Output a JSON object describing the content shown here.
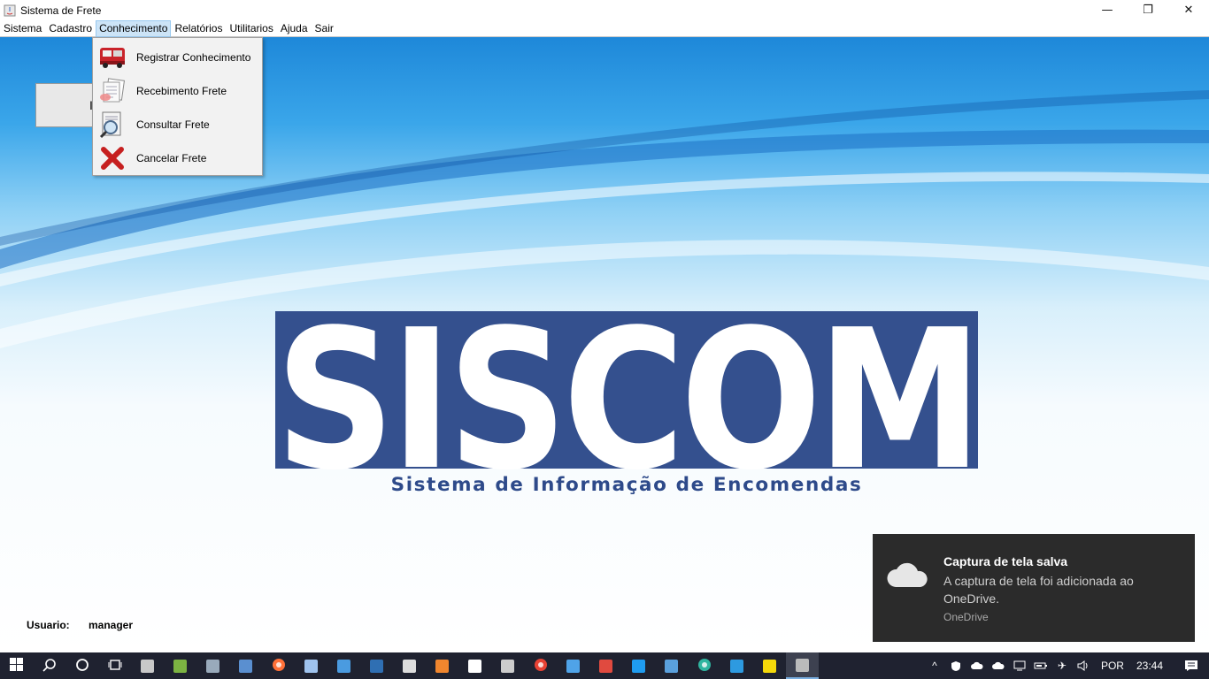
{
  "window": {
    "title": "Sistema de Frete",
    "controls": {
      "minimize": "—",
      "maximize": "❐",
      "close": "✕"
    }
  },
  "menubar": {
    "items": [
      {
        "label": "Sistema"
      },
      {
        "label": "Cadastro"
      },
      {
        "label": "Conhecimento",
        "active": true
      },
      {
        "label": "Relatórios"
      },
      {
        "label": "Utilitarios"
      },
      {
        "label": "Ajuda"
      },
      {
        "label": "Sair"
      }
    ]
  },
  "dropdown": {
    "items": [
      {
        "label": "Registrar Conhecimento",
        "icon": "truck-icon"
      },
      {
        "label": "Recebimento Frete",
        "icon": "documents-icon"
      },
      {
        "label": "Consultar Frete",
        "icon": "magnifier-document-icon"
      },
      {
        "label": "Cancelar Frete",
        "icon": "red-x-icon"
      }
    ]
  },
  "main": {
    "hidden_button_label": "I",
    "logo_text": "SISCOM",
    "logo_subtitle": "Sistema de Informação de Encomendas",
    "user_label": "Usuario:",
    "user_value": "manager"
  },
  "toast": {
    "title": "Captura de tela salva",
    "body": "A captura de tela foi adicionada ao OneDrive.",
    "source": "OneDrive"
  },
  "taskbar": {
    "icons": [
      {
        "name": "start-icon",
        "color": "#ffffff"
      },
      {
        "name": "search-icon",
        "color": "#ffffff"
      },
      {
        "name": "cortana-icon",
        "color": "#ffffff"
      },
      {
        "name": "task-view-icon",
        "color": "#ffffff"
      },
      {
        "name": "app-icon-1",
        "color": "#c8c8c8"
      },
      {
        "name": "android-studio-icon",
        "color": "#7cb342"
      },
      {
        "name": "app-icon-3",
        "color": "#9ab"
      },
      {
        "name": "app-icon-4",
        "color": "#5a8fd0"
      },
      {
        "name": "firefox-icon",
        "color": "#ff7139"
      },
      {
        "name": "virtualbox-icon",
        "color": "#9fc3ee"
      },
      {
        "name": "app-icon-7",
        "color": "#4a9be0"
      },
      {
        "name": "mysql-workbench-icon",
        "color": "#2f6fb3"
      },
      {
        "name": "app-icon-9",
        "color": "#ddd"
      },
      {
        "name": "sublime-icon",
        "color": "#f0862e"
      },
      {
        "name": "app-icon-11",
        "color": "#ffffff"
      },
      {
        "name": "cmd-icon",
        "color": "#cccccc"
      },
      {
        "name": "chrome-icon",
        "color": "#e84234"
      },
      {
        "name": "app-icon-14",
        "color": "#4fa3e8"
      },
      {
        "name": "app-icon-15",
        "color": "#e04a3f"
      },
      {
        "name": "vscode-icon",
        "color": "#1f9cf0"
      },
      {
        "name": "app-icon-17",
        "color": "#5aa0dc"
      },
      {
        "name": "edge-icon",
        "color": "#2fb5a0"
      },
      {
        "name": "ie-icon",
        "color": "#2d9ae0"
      },
      {
        "name": "sticky-notes-icon",
        "color": "#f5d90a"
      },
      {
        "name": "java-app-icon",
        "color": "#bbbbbb",
        "active": true
      }
    ],
    "tray": {
      "chevron": "^",
      "language": "POR",
      "time": "23:44"
    }
  }
}
